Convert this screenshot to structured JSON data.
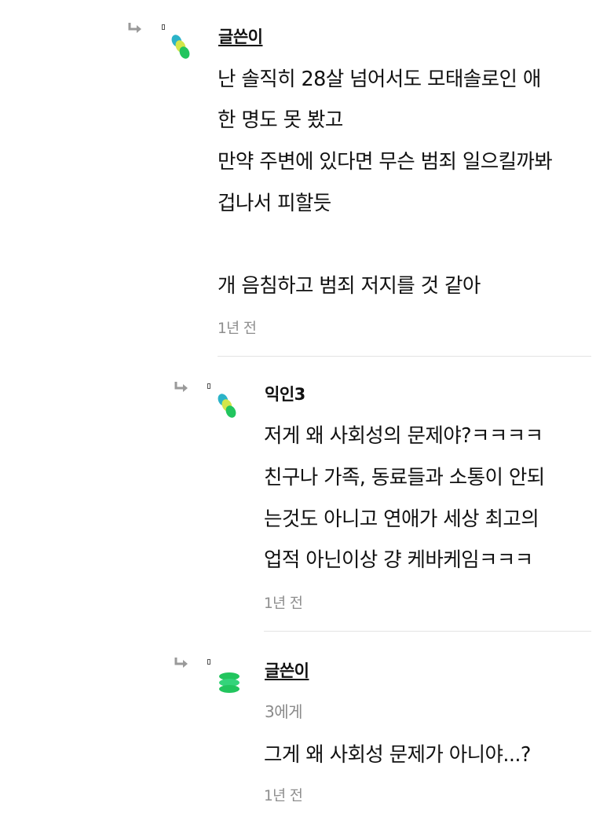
{
  "comments": [
    {
      "author": "글쓴이",
      "lines": [
        "난 솔직히 28살 넘어서도 모태솔로인 애",
        "한 명도 못 봤고",
        "만약 주변에 있다면 무슨 범죄 일으킬까봐",
        "겁나서 피할듯",
        "",
        "개 음침하고 범죄 저지를 것 같아"
      ],
      "time": "1년 전"
    },
    {
      "author": "익인3",
      "lines": [
        "저게 왜 사회성의 문제야?ㅋㅋㅋㅋ",
        "친구나 가족, 동료들과 소통이 안되",
        "는것도 아니고 연애가 세상 최고의",
        "업적 아닌이상 걍 케바케임ㅋㅋㅋ"
      ],
      "time": "1년 전"
    },
    {
      "author": "글쓴이",
      "recipient": "3에게",
      "lines": [
        "그게 왜 사회성 문제가 아니야...?"
      ],
      "time": "1년 전"
    }
  ],
  "colors": {
    "text": "#111111",
    "meta": "#8e8e8e",
    "divider": "#e3e3e3",
    "avatar_green": "#22c55e",
    "avatar_yellow": "#d4e64a",
    "avatar_teal": "#2bb3c8",
    "arrow": "#9a9a9a"
  },
  "icons": {
    "reply": "reply-arrow-icon",
    "avatar": "anonymous-avatar-icon"
  }
}
